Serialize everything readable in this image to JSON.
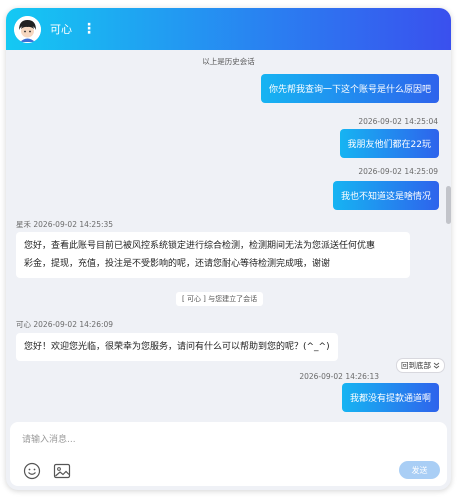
{
  "header": {
    "title": "可心",
    "more_icon": "more-vertical-icon",
    "avatar_icon": "agent-avatar-icon"
  },
  "history_note": "以上是历史会话",
  "messages": {
    "m1": {
      "text": "你先帮我查询一下这个账号是什么原因吧"
    },
    "m2": {
      "timestamp": "2026-09-02 14:25:04",
      "text": "我朋友他们都在22玩"
    },
    "m3": {
      "timestamp": "2026-09-02 14:25:09",
      "text": "我也不知道这是啥情况"
    },
    "m4": {
      "sender_line": "星禾 2026-09-02 14:25:35",
      "line1": "您好，查看此账号目前已被风控系统锁定进行综合检测，检测期间无法为您派送任何优惠",
      "line2": "彩金，提现，充值，投注是不受影响的呢，还请您耐心等待检测完成哦，谢谢"
    },
    "system_note": "[ 可心 ] 与您建立了会话",
    "m5": {
      "sender_line": "可心 2026-09-02 14:26:09",
      "text": "您好！欢迎您光临，很荣幸为您服务，请问有什么可以帮助到您的呢？(^_^)"
    },
    "m6": {
      "timestamp": "2026-09-02 14:26:13",
      "text": "我都没有提款通道啊"
    }
  },
  "back_to_bottom": "回到底部",
  "composer": {
    "placeholder": "请输入消息...",
    "emoji_icon": "smiley-icon",
    "image_icon": "image-icon",
    "send_label": "发送"
  },
  "colors": {
    "header_gradient": [
      "#14c9f3",
      "#3a50ee"
    ],
    "bubble_gradient": [
      "#16b4f2",
      "#2e63ec"
    ],
    "send_button": "#a9cef5"
  }
}
